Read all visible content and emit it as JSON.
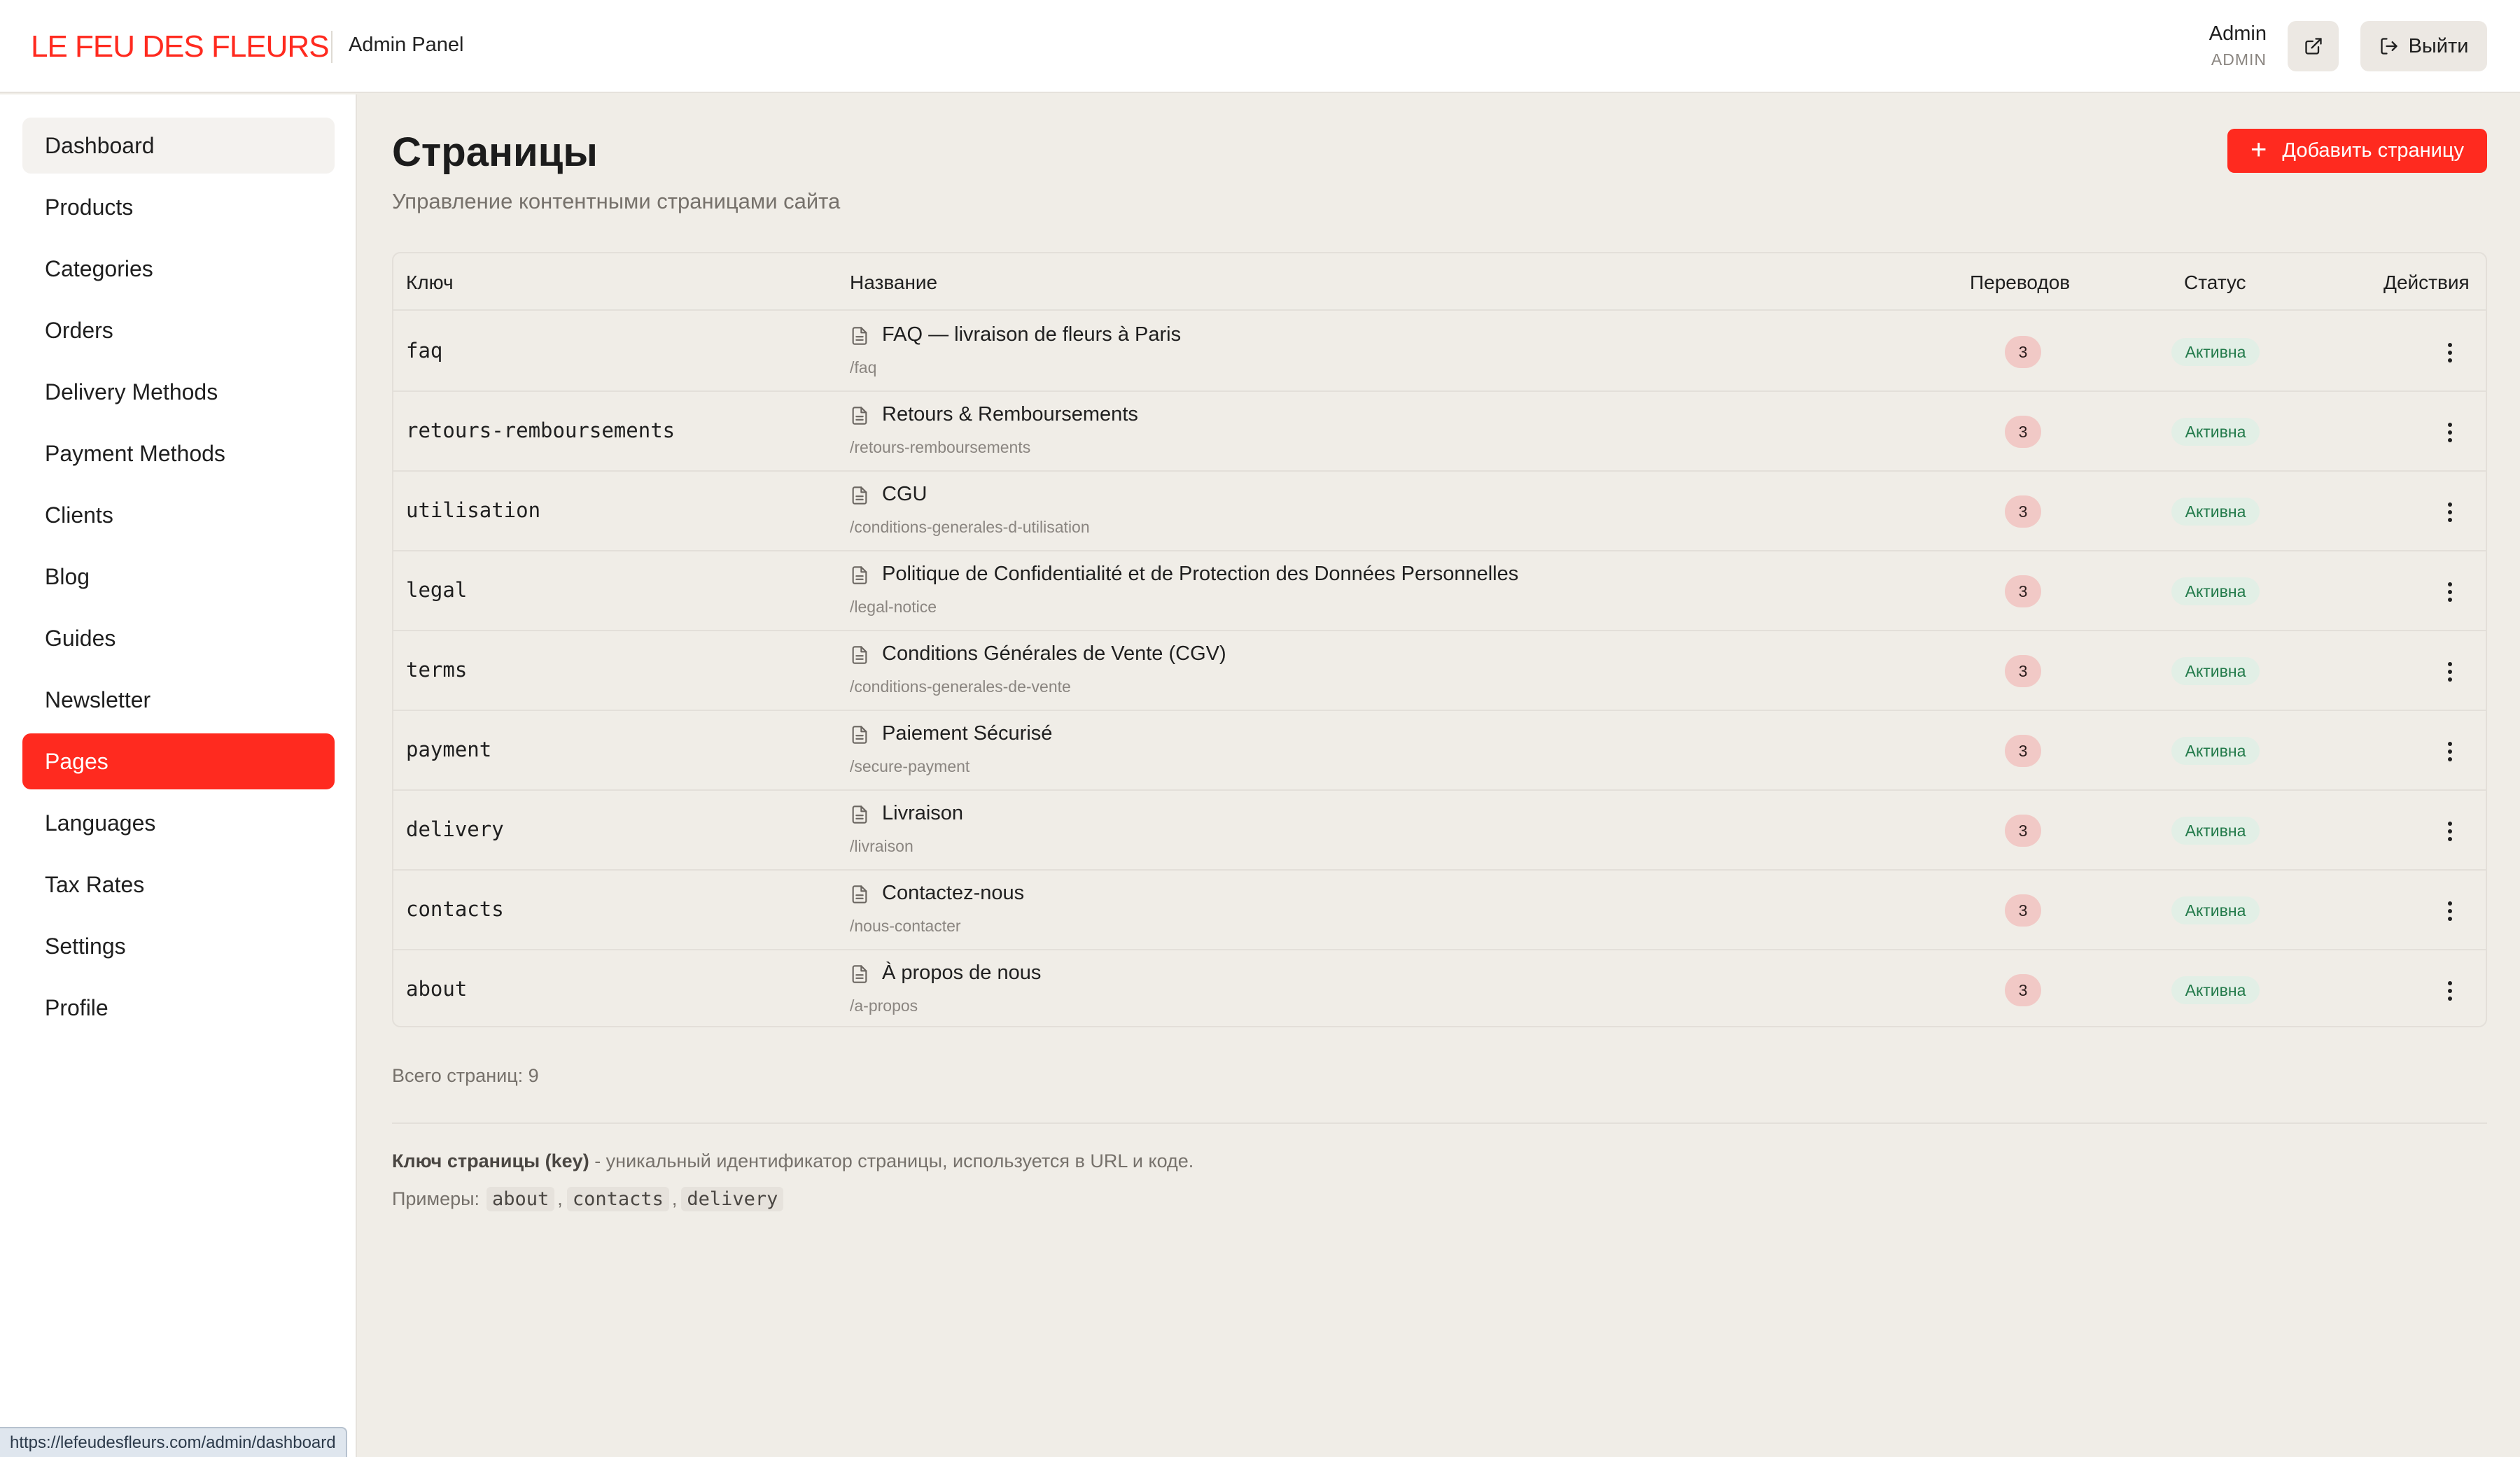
{
  "header": {
    "brand": "LE FEU DES FLEURS",
    "panel": "Admin Panel",
    "user_name": "Admin",
    "user_role": "ADMIN",
    "logout_label": "Выйти"
  },
  "sidebar": {
    "items": [
      {
        "label": "Dashboard"
      },
      {
        "label": "Products"
      },
      {
        "label": "Categories"
      },
      {
        "label": "Orders"
      },
      {
        "label": "Delivery Methods"
      },
      {
        "label": "Payment Methods"
      },
      {
        "label": "Clients"
      },
      {
        "label": "Blog"
      },
      {
        "label": "Guides"
      },
      {
        "label": "Newsletter"
      },
      {
        "label": "Pages"
      },
      {
        "label": "Languages"
      },
      {
        "label": "Tax Rates"
      },
      {
        "label": "Settings"
      },
      {
        "label": "Profile"
      }
    ],
    "active_index": 10,
    "hover_index": 0
  },
  "main": {
    "title": "Страницы",
    "subtitle": "Управление контентными страницами сайта",
    "add_button": "Добавить страницу",
    "columns": {
      "key": "Ключ",
      "name": "Название",
      "translations": "Переводов",
      "status": "Статус",
      "actions": "Действия"
    },
    "rows": [
      {
        "key": "faq",
        "title": "FAQ — livraison de fleurs à Paris",
        "path": "/faq",
        "translations": "3",
        "status": "Активна"
      },
      {
        "key": "retours-remboursements",
        "title": "Retours & Remboursements",
        "path": "/retours-remboursements",
        "translations": "3",
        "status": "Активна"
      },
      {
        "key": "utilisation",
        "title": "CGU",
        "path": "/conditions-generales-d-utilisation",
        "translations": "3",
        "status": "Активна"
      },
      {
        "key": "legal",
        "title": "Politique de Confidentialité et de Protection des Données Personnelles",
        "path": "/legal-notice",
        "translations": "3",
        "status": "Активна"
      },
      {
        "key": "terms",
        "title": "Conditions Générales de Vente (CGV)",
        "path": "/conditions-generales-de-vente",
        "translations": "3",
        "status": "Активна"
      },
      {
        "key": "payment",
        "title": "Paiement Sécurisé",
        "path": "/secure-payment",
        "translations": "3",
        "status": "Активна"
      },
      {
        "key": "delivery",
        "title": "Livraison",
        "path": "/livraison",
        "translations": "3",
        "status": "Активна"
      },
      {
        "key": "contacts",
        "title": "Contactez-nous",
        "path": "/nous-contacter",
        "translations": "3",
        "status": "Активна"
      },
      {
        "key": "about",
        "title": "À propos de nous",
        "path": "/a-propos",
        "translations": "3",
        "status": "Активна"
      }
    ],
    "total": "Всего страниц: 9",
    "help_bold": "Ключ страницы (key)",
    "help_text": " - уникальный идентификатор страницы, используется в URL и коде.",
    "examples_label": "Примеры:",
    "examples": [
      "about",
      "contacts",
      "delivery"
    ]
  },
  "status_bar_url": "https://lefeudesfleurs.com/admin/dashboard",
  "colors": {
    "accent": "#ff2a1f",
    "background": "#f0ede7",
    "badge_count_bg": "#f1c9c6",
    "status_bg": "#e2efe6",
    "status_text": "#227a4a"
  }
}
